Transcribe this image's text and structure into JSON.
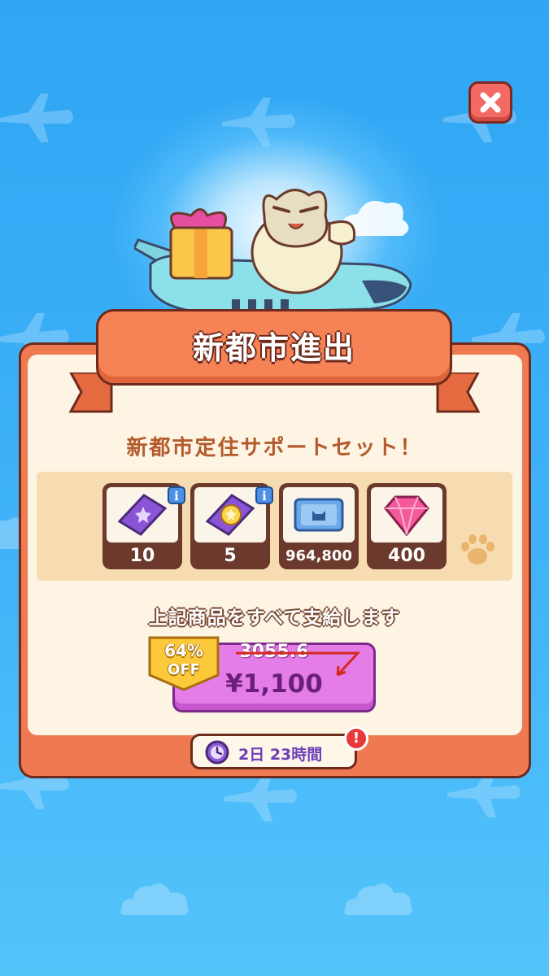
{
  "popup": {
    "title": "新都市進出",
    "subtitle": "新都市定住サポートセット！",
    "description": "上記商品をすべて支給します"
  },
  "items": [
    {
      "icon": "purple-star-ticket-icon",
      "count": "10",
      "has_info": true
    },
    {
      "icon": "gold-star-ticket-icon",
      "count": "5",
      "has_info": true
    },
    {
      "icon": "coin-bill-icon",
      "count": "964,800",
      "has_info": false
    },
    {
      "icon": "pink-gem-icon",
      "count": "400",
      "has_info": false
    }
  ],
  "purchase": {
    "discount_percent": "64%",
    "discount_label": "OFF",
    "original_price": "3055.6",
    "price": "¥1,100"
  },
  "timer": {
    "remaining": "2日 23時間"
  },
  "colors": {
    "background": "#41b4f8",
    "panel": "#ef7a52",
    "panel_inner": "#fdf4e4",
    "buy_button": "#e57de9",
    "close_button": "#f26a63"
  }
}
